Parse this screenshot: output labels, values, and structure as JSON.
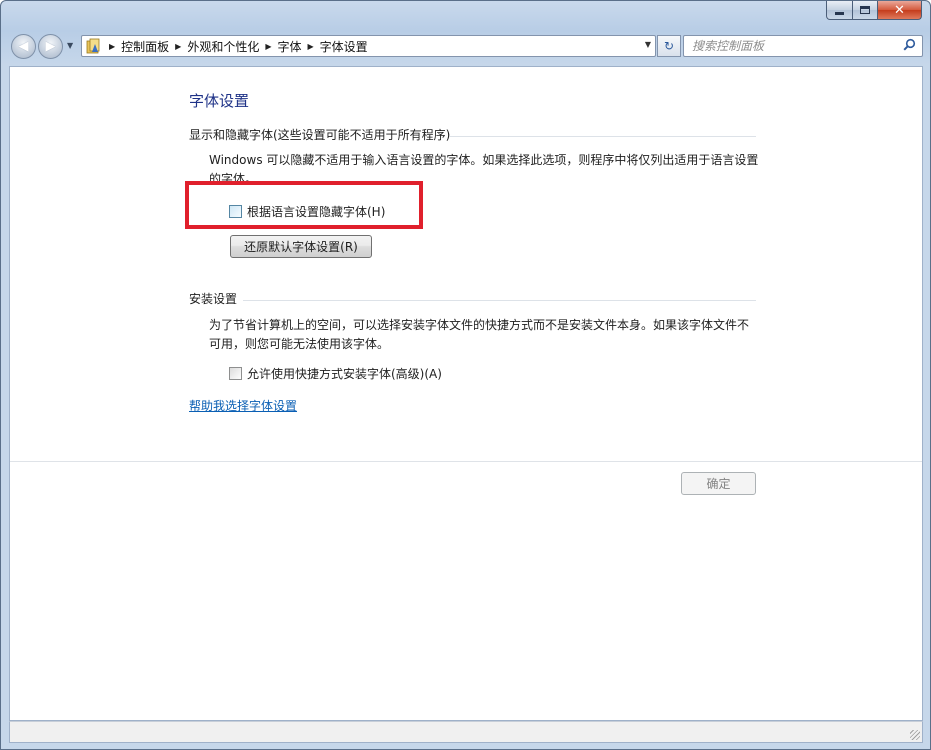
{
  "window": {
    "caption": {
      "minimize": "",
      "maximize": "",
      "close": "✕"
    }
  },
  "navbar": {
    "back_glyph": "◀",
    "forward_glyph": "▶",
    "breadcrumbs": [
      "控制面板",
      "外观和个性化",
      "字体",
      "字体设置"
    ],
    "refresh_glyph": "↻",
    "search": {
      "placeholder": "搜索控制面板"
    }
  },
  "page": {
    "title": "字体设置",
    "section_show_hide": {
      "heading": "显示和隐藏字体(这些设置可能不适用于所有程序)",
      "description": "Windows 可以隐藏不适用于输入语言设置的字体。如果选择此选项，则程序中将仅列出适用于语言设置的字体。",
      "checkbox_label": "根据语言设置隐藏字体(H)",
      "checkbox_checked": false,
      "restore_button": "还原默认字体设置(R)"
    },
    "section_install": {
      "heading": "安装设置",
      "description": "为了节省计算机上的空间，可以选择安装字体文件的快捷方式而不是安装文件本身。如果该字体文件不可用，则您可能无法使用该字体。",
      "checkbox_label": "允许使用快捷方式安装字体(高级)(A)",
      "checkbox_checked": false
    },
    "help_link": "帮助我选择字体设置",
    "ok_button": "确定"
  },
  "colors": {
    "highlight_box": "#e0202c",
    "title_blue": "#1e3287",
    "link_blue": "#0a5fb4"
  }
}
